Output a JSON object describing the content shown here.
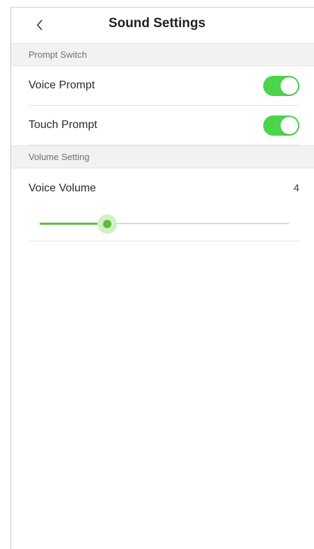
{
  "header": {
    "title": "Sound Settings",
    "back_icon": "chevron-left-icon"
  },
  "sections": {
    "prompt_switch": "Prompt Switch",
    "volume_setting": "Volume Setting"
  },
  "prompts": {
    "voice_prompt": {
      "label": "Voice Prompt",
      "enabled": true
    },
    "touch_prompt": {
      "label": "Touch Prompt",
      "enabled": true
    }
  },
  "volume": {
    "label": "Voice Volume",
    "value": "4",
    "level_fraction": 0.27
  },
  "colors": {
    "accent": "#4cd44b",
    "slider": "#5dbf3b"
  }
}
